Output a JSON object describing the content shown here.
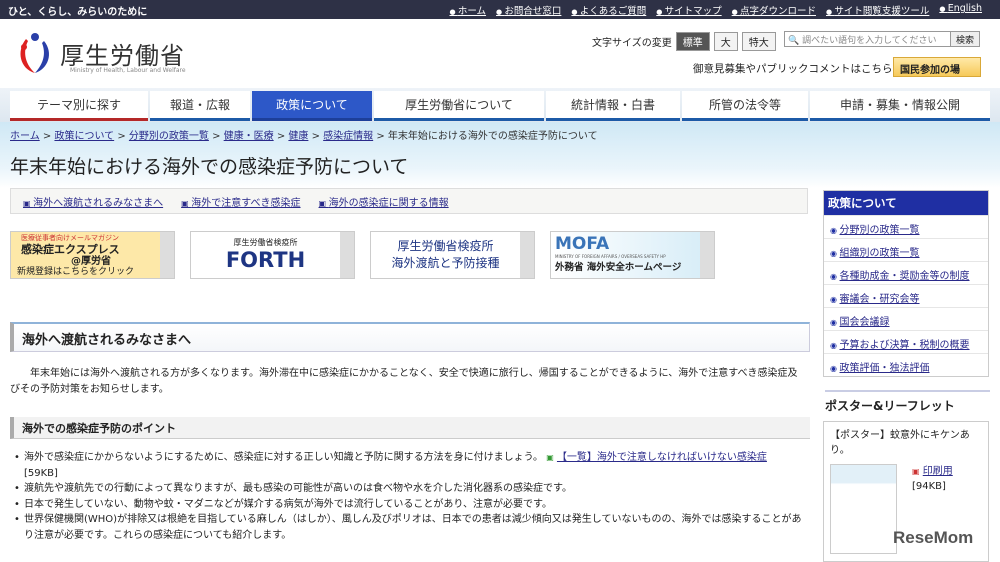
{
  "top": {
    "tagline": "ひと、くらし、みらいのために",
    "links": [
      "ホーム",
      "お問合せ窓口",
      "よくあるご質問",
      "サイトマップ",
      "点字ダウンロード",
      "サイト閲覧支援ツール",
      "English"
    ]
  },
  "header": {
    "logo_title": "厚生労働省",
    "logo_en": "Ministry of Health, Labour and Welfare",
    "font_size_label": "文字サイズの変更",
    "font_sizes": [
      "標準",
      "大",
      "特大"
    ],
    "search_placeholder": "調べたい語句を入力してください",
    "search_button": "検索",
    "opinion": "御意見募集やパブリックコメントはこちら",
    "kokumin": "国民参加の場"
  },
  "nav": [
    "テーマ別に探す",
    "報道・広報",
    "政策について",
    "厚生労働省について",
    "統計情報・白書",
    "所管の法令等",
    "申請・募集・情報公開"
  ],
  "breadcrumb": [
    "ホーム",
    "政策について",
    "分野別の政策一覧",
    "健康・医療",
    "健康",
    "感染症情報",
    "年末年始における海外での感染症予防について"
  ],
  "title": "年末年始における海外での感染症予防について",
  "anchors": [
    "海外へ渡航されるみなさまへ",
    "海外で注意すべき感染症",
    "海外の感染症に関する情報"
  ],
  "banners": {
    "b1": [
      "医療従事者向けメールマガジン",
      "感染症エクスプレス",
      "@厚労省",
      "新規登録はこちらをクリック"
    ],
    "b2": [
      "厚生労働省検疫所",
      "FORTH"
    ],
    "b3": [
      "厚生労働省検疫所",
      "海外渡航と予防接種"
    ],
    "b4": [
      "MOFA",
      "MINISTRY OF FOREIGN AFFAIRS / OVERSEAS SAFETY HP",
      "外務省 海外安全ホームページ"
    ]
  },
  "section": {
    "heading": "海外へ渡航されるみなさまへ",
    "para": "年末年始には海外へ渡航される方が多くなります。海外滞在中に感染症にかかることなく、安全で快適に旅行し、帰国することができるように、海外で注意すべき感染症及びその予防対策をお知らせします。",
    "sub": "海外での感染症予防のポイント",
    "b1_text": "海外で感染症にかからないようにするために、感染症に対する正しい知識と予防に関する方法を身に付けましょう。",
    "b1_link": "【一覧】海外で注意しなければいけない感染症",
    "b1_size": "[59KB]",
    "bullets": [
      "渡航先や渡航先での行動によって異なりますが、最も感染の可能性が高いのは食べ物や水を介した消化器系の感染症です。",
      "日本で発生していない、動物や蚊・マダニなどが媒介する病気が海外では流行していることがあり、注意が必要です。",
      "世界保健機関(WHO)が排除又は根絶を目指している麻しん（はしか）、風しん及びポリオは、日本での患者は減少傾向又は発生していないものの、海外では感染することがあり注意が必要です。これらの感染症についても紹介します。"
    ]
  },
  "sidebar": {
    "heading": "政策について",
    "items": [
      "分野別の政策一覧",
      "組織別の政策一覧",
      "各種助成金・奨励金等の制度",
      "審議会・研究会等",
      "国会会議録",
      "予算および決算・税制の概要",
      "政策評価・独法評価"
    ]
  },
  "poster": {
    "heading": "ポスター&リーフレット",
    "title": "【ポスター】蚊意外にキケンあり。",
    "print": "印刷用",
    "size": "[94KB]"
  },
  "watermark": "ReseMom"
}
